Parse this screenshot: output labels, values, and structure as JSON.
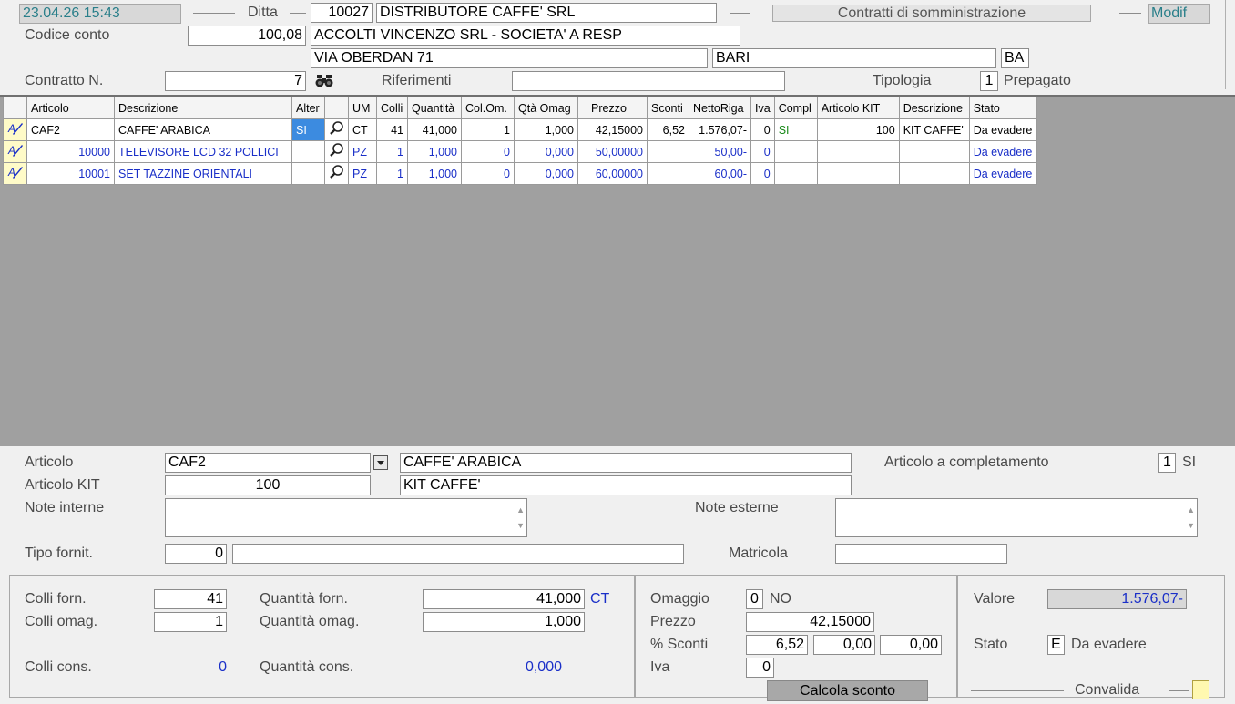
{
  "header": {
    "datetime": "23.04.26 15:43",
    "ditta_label": "Ditta",
    "ditta_code": "10027",
    "ditta_name": "DISTRIBUTORE CAFFE' SRL",
    "window_title": "Contratti di somministrazione",
    "mode": "Modif",
    "codice_conto_label": "Codice conto",
    "codice_conto": "100,08",
    "cliente_name": "ACCOLTI VINCENZO SRL - SOCIETA' A RESP",
    "address": "VIA OBERDAN 71",
    "city": "BARI",
    "province": "BA",
    "contratto_label": "Contratto N.",
    "contratto": "7",
    "riferimenti_label": "Riferimenti",
    "riferimenti": "",
    "tipologia_label": "Tipologia",
    "tipologia": "1",
    "tipologia_desc": "Prepagato"
  },
  "grid": {
    "columns": [
      "Articolo",
      "Descrizione",
      "Alter",
      "",
      "UM",
      "Colli",
      "Quantità",
      "Col.Om.",
      "Qtà Omag",
      "",
      "Prezzo",
      "Sconti",
      "NettoRiga",
      "Iva",
      "Compl",
      "Articolo KIT",
      "Descrizione",
      "Stato"
    ],
    "rows": [
      {
        "articolo": "CAF2",
        "descrizione": "CAFFE' ARABICA",
        "alter": "SI",
        "um": "CT",
        "colli": "41",
        "quantita": "41,000",
        "col_om": "1",
        "qta_omag": "1,000",
        "prezzo": "42,15000",
        "sconti": "6,52",
        "netto": "1.576,07-",
        "iva": "0",
        "compl": "SI",
        "art_kit": "100",
        "desc_kit": "KIT CAFFE'",
        "stato": "Da evadere"
      },
      {
        "articolo": "10000",
        "descrizione": "TELEVISORE  LCD 32 POLLICI",
        "alter": "",
        "um": "PZ",
        "colli": "1",
        "quantita": "1,000",
        "col_om": "0",
        "qta_omag": "0,000",
        "prezzo": "50,00000",
        "sconti": "",
        "netto": "50,00-",
        "iva": "0",
        "compl": "",
        "art_kit": "",
        "desc_kit": "",
        "stato": "Da evadere"
      },
      {
        "articolo": "10001",
        "descrizione": "SET TAZZINE ORIENTALI",
        "alter": "",
        "um": "PZ",
        "colli": "1",
        "quantita": "1,000",
        "col_om": "0",
        "qta_omag": "0,000",
        "prezzo": "60,00000",
        "sconti": "",
        "netto": "60,00-",
        "iva": "0",
        "compl": "",
        "art_kit": "",
        "desc_kit": "",
        "stato": "Da evadere"
      }
    ]
  },
  "detail": {
    "articolo_label": "Articolo",
    "articolo": "CAF2",
    "articolo_desc": "CAFFE' ARABICA",
    "completamento_label": "Articolo a completamento",
    "completamento": "1",
    "completamento_desc": "SI",
    "kit_label": "Articolo KIT",
    "kit": "100",
    "kit_desc": "KIT CAFFE'",
    "note_interne_label": "Note interne",
    "note_esterne_label": "Note esterne",
    "tipo_fornit_label": "Tipo fornit.",
    "tipo_fornit": "0",
    "tipo_fornit_desc": "",
    "matricola_label": "Matricola",
    "matricola": ""
  },
  "quantities": {
    "colli_forn_label": "Colli forn.",
    "colli_forn": "41",
    "colli_omag_label": "Colli omag.",
    "colli_omag": "1",
    "colli_cons_label": "Colli cons.",
    "colli_cons": "0",
    "qta_forn_label": "Quantità forn.",
    "qta_forn": "41,000",
    "qta_forn_um": "CT",
    "qta_omag_label": "Quantità omag.",
    "qta_omag": "1,000",
    "qta_cons_label": "Quantità cons.",
    "qta_cons": "0,000"
  },
  "pricing": {
    "omaggio_label": "Omaggio",
    "omaggio": "0",
    "omaggio_desc": "NO",
    "prezzo_label": "Prezzo",
    "prezzo": "42,15000",
    "sconti_label": "% Sconti",
    "sconto1": "6,52",
    "sconto2": "0,00",
    "sconto3": "0,00",
    "iva_label": "Iva",
    "iva": "0",
    "calcola_label": "Calcola sconto"
  },
  "summary": {
    "valore_label": "Valore",
    "valore": "1.576,07-",
    "stato_label": "Stato",
    "stato": "E",
    "stato_desc": "Da evadere",
    "convalida_label": "Convalida"
  },
  "colors": {
    "accent_teal": "#2a7f8a",
    "value_blue": "#1a2fc8",
    "grid_bg": "#a0a0a0",
    "selected": "#3c8be0"
  }
}
